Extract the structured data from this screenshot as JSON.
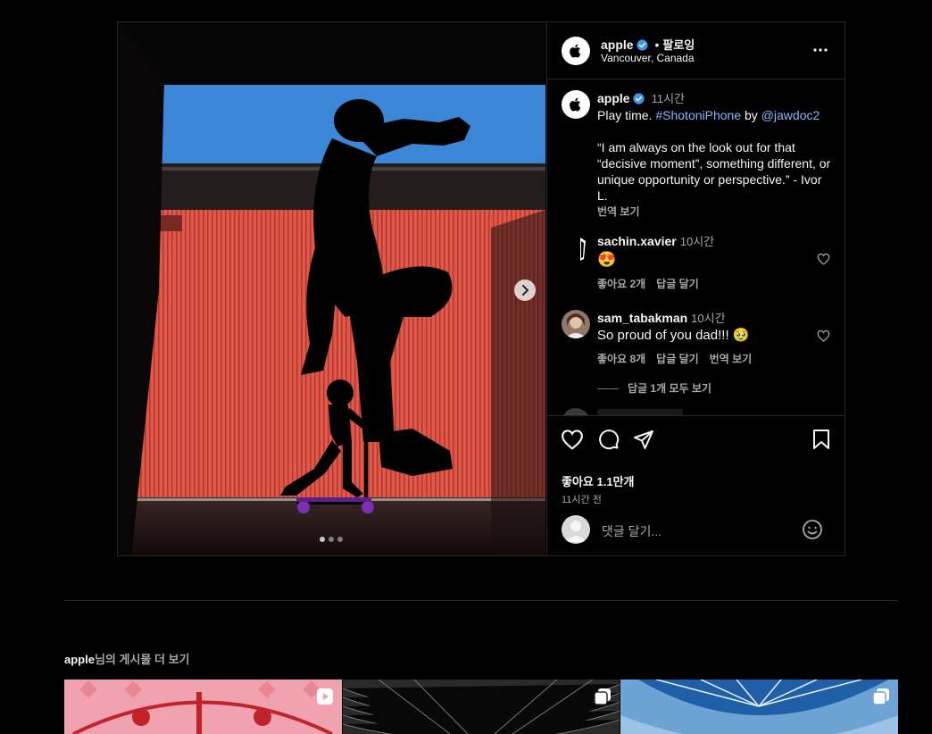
{
  "post": {
    "username": "apple",
    "dot": "•",
    "follow_label": "팔로잉",
    "location": "Vancouver, Canada",
    "carousel": {
      "slide_count": 3,
      "active_slide": 1
    }
  },
  "caption": {
    "username": "apple",
    "time": "11시간",
    "text_plain": "Play time. ",
    "hashtag": "#ShotoniPhone",
    "by_word": " by ",
    "mention": "@jawdoc2",
    "quote": "“I am always on the look out for that “decisive moment”, something different, or unique opportunity or perspective.” - Ivor L.",
    "translate": "번역 보기"
  },
  "comments": [
    {
      "username": "sachin.xavier",
      "time": "10시간",
      "text": "😍",
      "likes": "좋아요 2개",
      "reply": "답글 달기"
    },
    {
      "username": "sam_tabakman",
      "time": "10시간",
      "text": "So proud of you dad!!! 🥹",
      "likes": "좋아요 8개",
      "reply": "답글 달기",
      "translate": "번역 보기",
      "view_replies": "답글 1개 모두 보기"
    }
  ],
  "actions": {
    "likes_count": "좋아요 1.1만개",
    "time_ago": "11시간 전"
  },
  "comment_input": {
    "placeholder": "댓글 달기..."
  },
  "more_posts": {
    "username": "apple",
    "suffix": "님의 게시물 더 보기"
  },
  "colors": {
    "background": "#000000",
    "accent_link": "#8ab4ff",
    "verified": "#3897f0",
    "border": "#262626"
  }
}
